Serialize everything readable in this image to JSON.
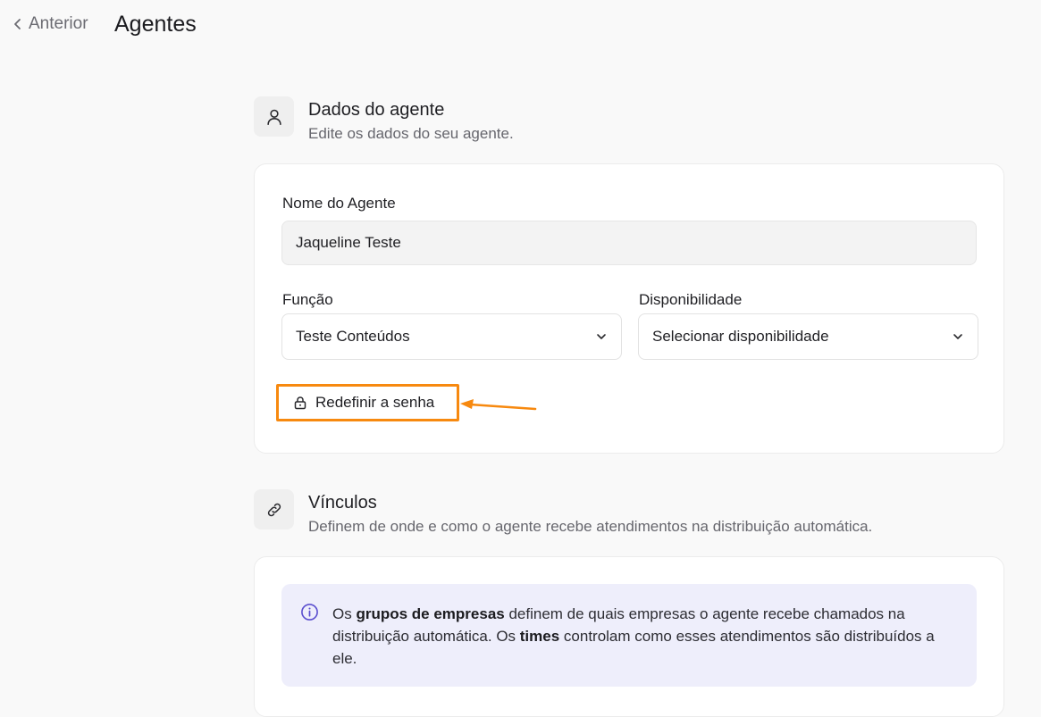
{
  "header": {
    "back_label": "Anterior",
    "title": "Agentes"
  },
  "agent_section": {
    "icon": "user-icon",
    "title": "Dados do agente",
    "subtitle": "Edite os dados do seu agente."
  },
  "agent_form": {
    "name_label": "Nome do Agente",
    "name_value": "Jaqueline Teste",
    "role_label": "Função",
    "role_value": "Teste Conteúdos",
    "availability_label": "Disponibilidade",
    "availability_value": "Selecionar disponibilidade",
    "reset_password_label": "Redefinir a senha"
  },
  "links_section": {
    "icon": "link-icon",
    "title": "Vínculos",
    "subtitle": "Definem de onde e como o agente recebe atendimentos na distribuição automática."
  },
  "info_box": {
    "icon": "info-icon",
    "part1": "Os ",
    "bold1": "grupos de empresas",
    "part2": " definem de quais empresas o agente recebe chamados na distribuição automática. Os ",
    "bold2": "times",
    "part3": " controlam como esses atendimentos são distribuídos a ele."
  },
  "colors": {
    "highlight": "#f7890f",
    "info_bg": "#eeeefb",
    "info_icon": "#5b4fcf"
  }
}
